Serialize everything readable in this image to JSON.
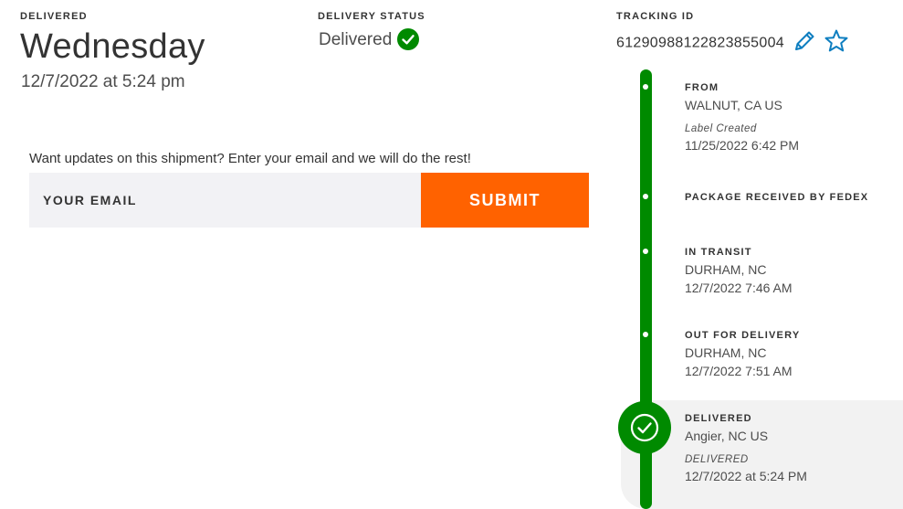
{
  "summary": {
    "delivered_label": "DELIVERED",
    "day": "Wednesday",
    "datetime": "12/7/2022 at 5:24 pm",
    "status_label": "DELIVERY STATUS",
    "status_value": "Delivered",
    "tracking_label": "TRACKING ID",
    "tracking_id": "612909881228238550​04"
  },
  "updates": {
    "prompt": "Want updates on this shipment? Enter your email and we will do the rest!",
    "email_placeholder": "YOUR EMAIL",
    "submit_label": "SUBMIT"
  },
  "icons": {
    "status": "check-circle-icon",
    "edit": "pencil-icon",
    "favorite": "star-outline-icon",
    "delivered": "check-circle-icon"
  },
  "colors": {
    "green": "#008a00",
    "orange": "#ff6200",
    "icon_blue": "#0d7ec0"
  },
  "timeline": [
    {
      "title": "FROM",
      "location": "WALNUT, CA US",
      "note": "Label Created",
      "time": "11/25/2022 6:42 PM"
    },
    {
      "title": "PACKAGE RECEIVED BY FEDEX"
    },
    {
      "title": "IN TRANSIT",
      "location": "DURHAM, NC",
      "time": "12/7/2022 7:46 AM"
    },
    {
      "title": "OUT FOR DELIVERY",
      "location": "DURHAM, NC",
      "time": "12/7/2022 7:51 AM"
    },
    {
      "title": "DELIVERED",
      "location": "Angier, NC US",
      "note": "DELIVERED",
      "time": "12/7/2022 at 5:24 PM"
    }
  ]
}
